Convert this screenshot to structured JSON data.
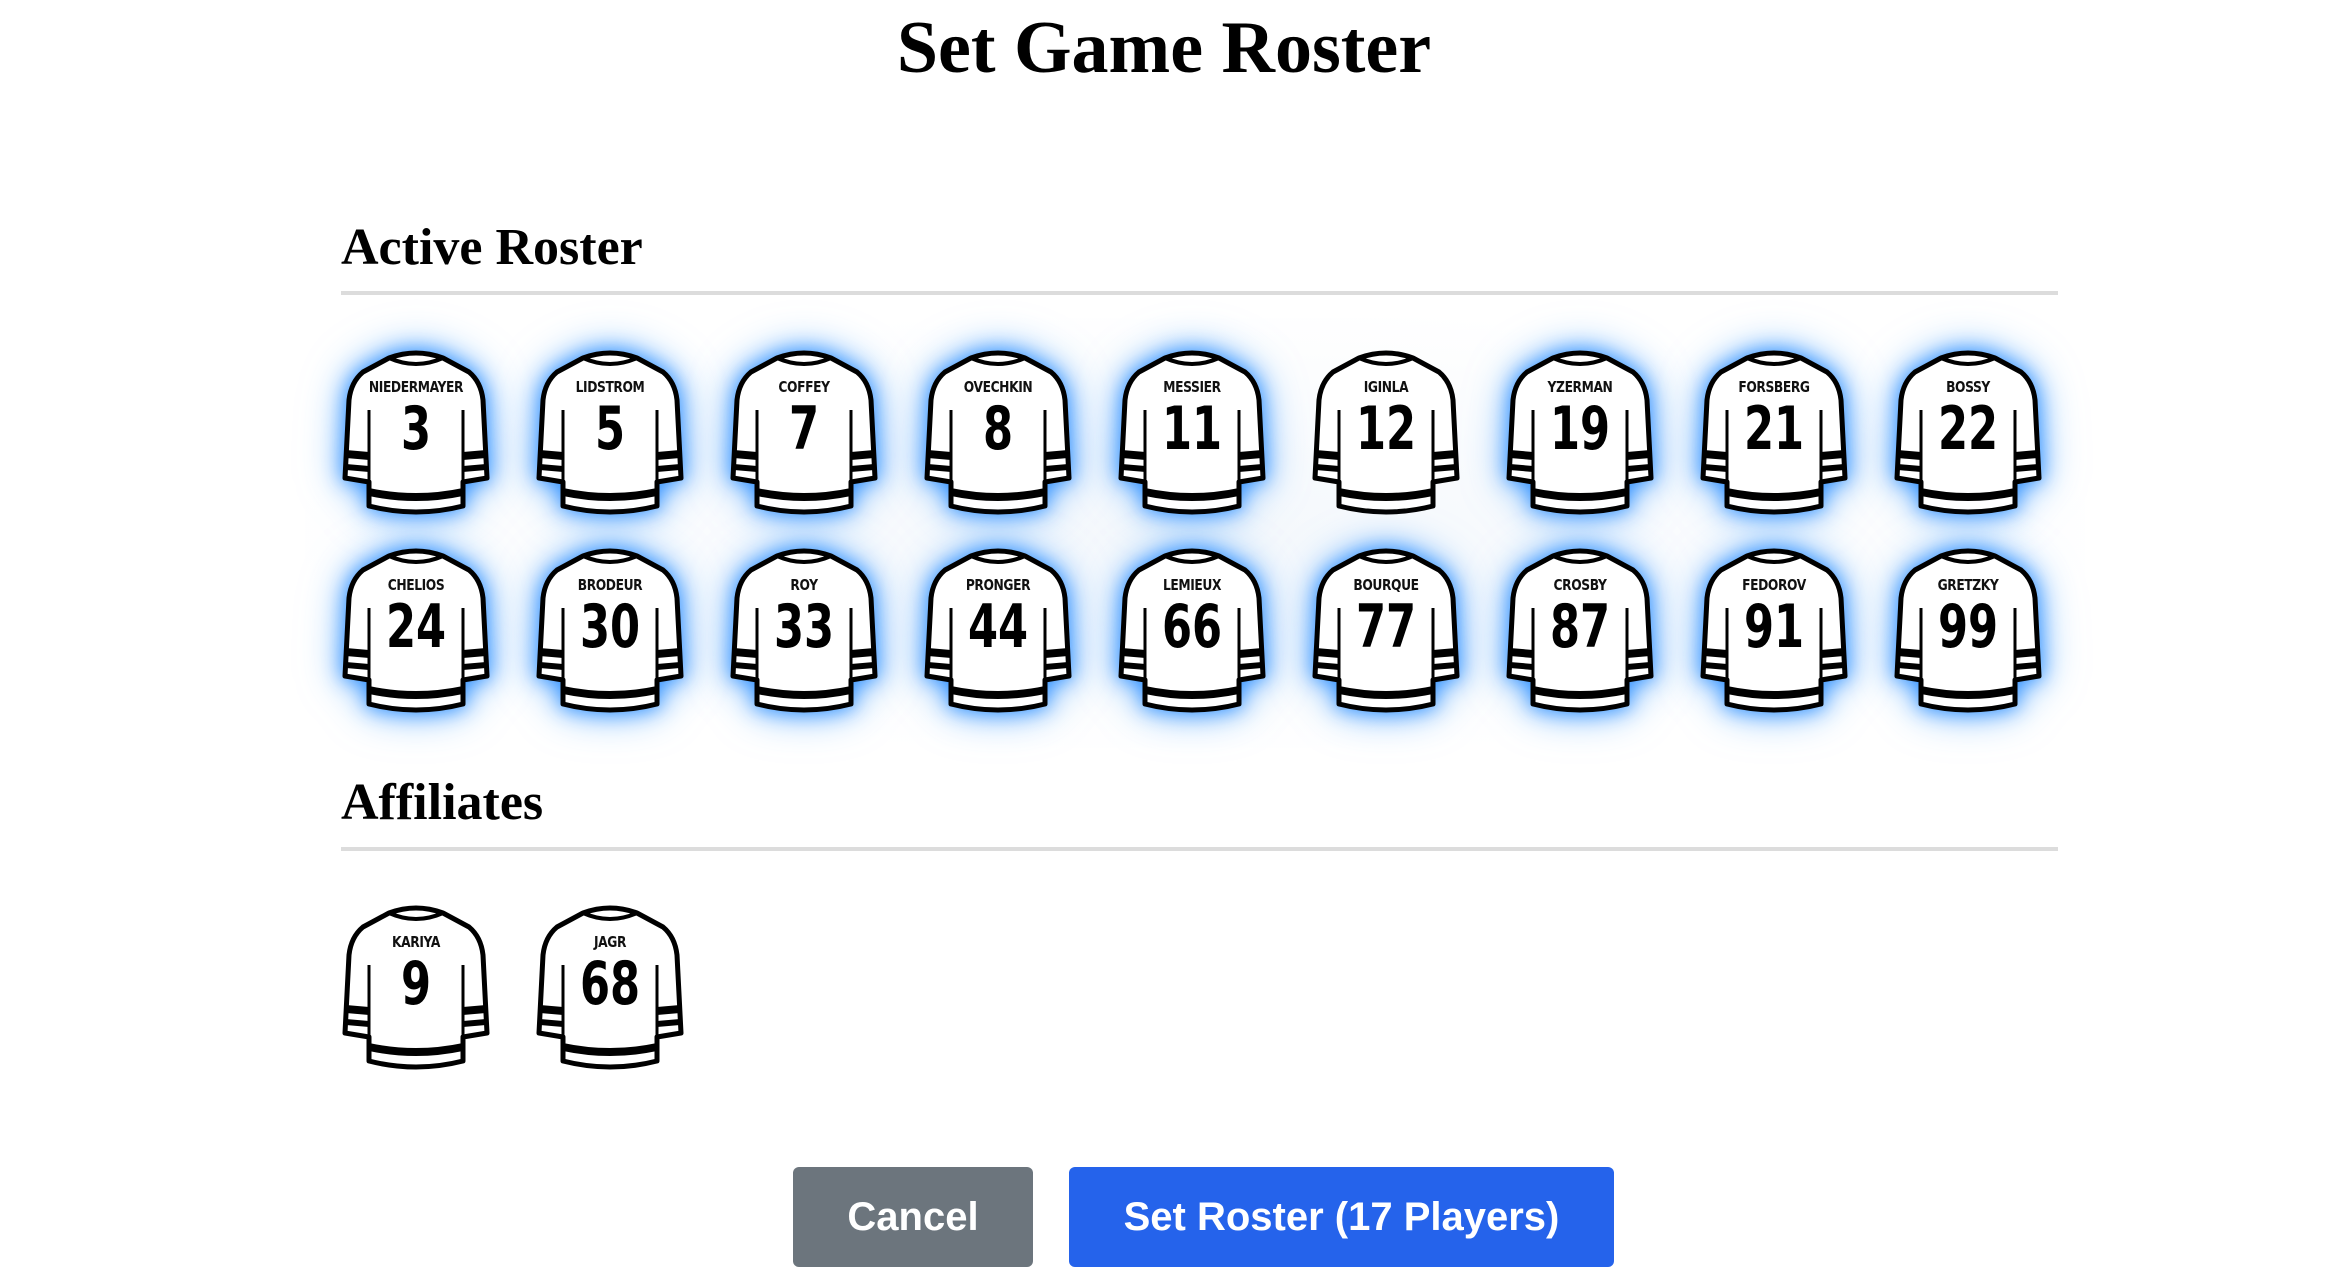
{
  "page": {
    "title": "Set Game Roster"
  },
  "active_roster": {
    "heading": "Active Roster",
    "players": [
      {
        "name": "NIEDERMAYER",
        "number": "3"
      },
      {
        "name": "LIDSTROM",
        "number": "5"
      },
      {
        "name": "COFFEY",
        "number": "7"
      },
      {
        "name": "OVECHKIN",
        "number": "8"
      },
      {
        "name": "MESSIER",
        "number": "11"
      },
      {
        "name": "IGINLA",
        "number": "12"
      },
      {
        "name": "YZERMAN",
        "number": "19"
      },
      {
        "name": "FORSBERG",
        "number": "21"
      },
      {
        "name": "BOSSY",
        "number": "22"
      },
      {
        "name": "CHELIOS",
        "number": "24"
      },
      {
        "name": "BRODEUR",
        "number": "30"
      },
      {
        "name": "ROY",
        "number": "33"
      },
      {
        "name": "PRONGER",
        "number": "44"
      },
      {
        "name": "LEMIEUX",
        "number": "66"
      },
      {
        "name": "BOURQUE",
        "number": "77"
      },
      {
        "name": "CROSBY",
        "number": "87"
      },
      {
        "name": "FEDOROV",
        "number": "91"
      },
      {
        "name": "GRETZKY",
        "number": "99"
      }
    ],
    "highlighted_count_note": null
  },
  "affiliates": {
    "heading": "Affiliates",
    "players": [
      {
        "name": "KARIYA",
        "number": "9"
      },
      {
        "name": "JAGR",
        "number": "68"
      }
    ]
  },
  "buttons": {
    "cancel_label": "Cancel",
    "submit_label": "Set Roster (17 Players)"
  },
  "colors": {
    "selected_glow": "#2a8cff",
    "cancel_bg": "#6c757d",
    "submit_bg": "#2563eb",
    "rule": "#dcdcdc"
  },
  "icons": {
    "jersey": "hockey-jersey-icon"
  }
}
